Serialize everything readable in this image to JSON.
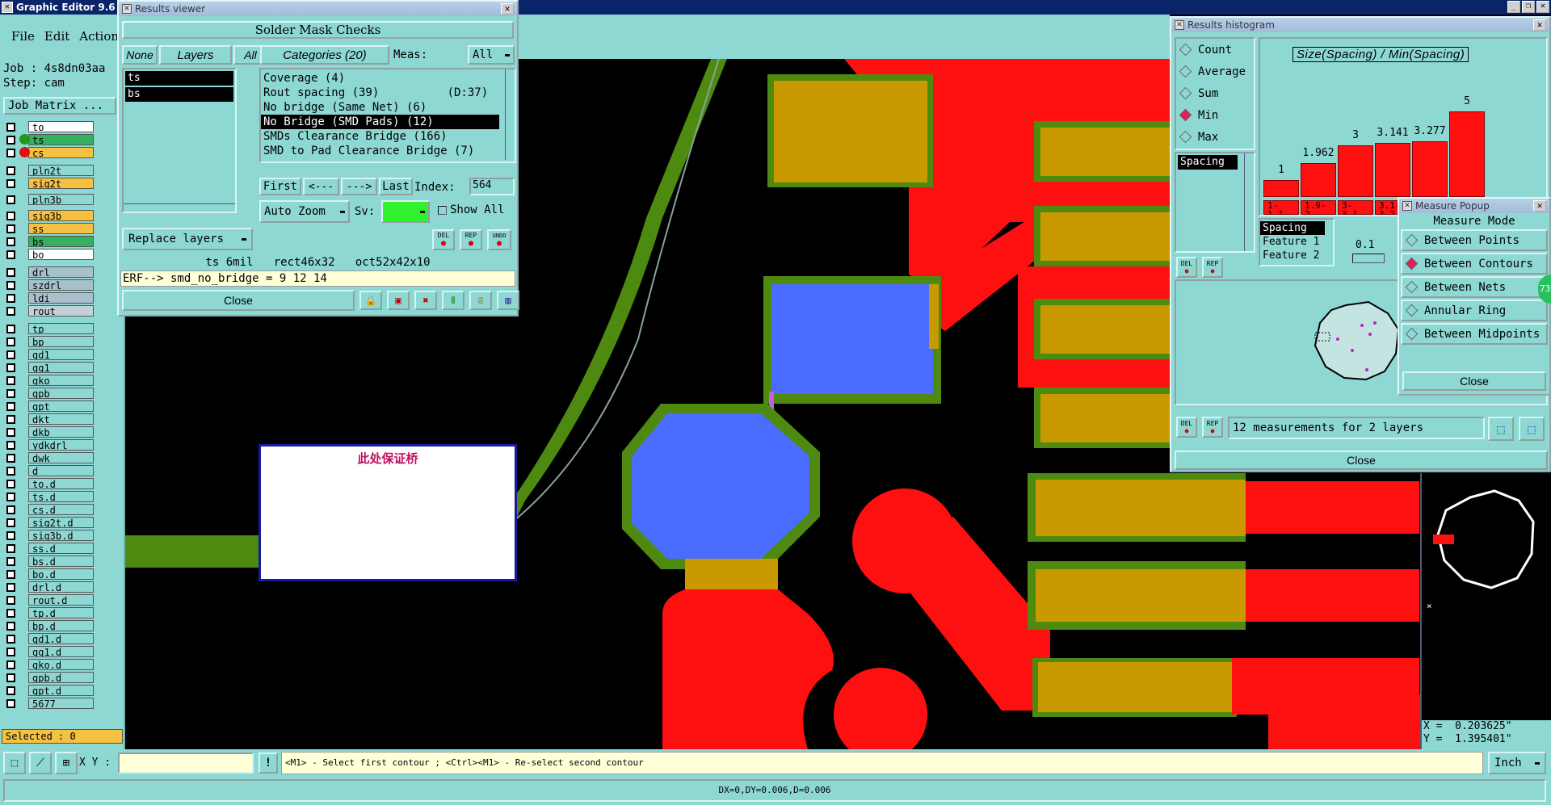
{
  "app": {
    "title": "Graphic Editor 9.6"
  },
  "menu": {
    "file": "File",
    "edit": "Edit",
    "action": "Action"
  },
  "job": {
    "line1": "Job : 4s8dn03aa",
    "line2": "Step: cam",
    "matrix_button": "Job Matrix ..."
  },
  "layers": [
    {
      "name": "to",
      "color": "#ffffff"
    },
    {
      "name": "ts",
      "color": "#34b060",
      "dot": "#1e9a1e"
    },
    {
      "name": "cs",
      "color": "#f6c040",
      "dot": "#e01010"
    },
    {
      "name": "pln2t",
      "color": "#8ed8d4"
    },
    {
      "name": "sig2t",
      "color": "#f6c040"
    },
    {
      "name": "pln3b",
      "color": "#8ed8d4"
    },
    {
      "name": "sig3b",
      "color": "#f6c040"
    },
    {
      "name": "ss",
      "color": "#f6c040"
    },
    {
      "name": "bs",
      "color": "#34b060"
    },
    {
      "name": "bo",
      "color": "#ffffff"
    },
    {
      "name": "drl",
      "color": "#a8c0cc"
    },
    {
      "name": "szdrl",
      "color": "#a8c0cc"
    },
    {
      "name": "ldi",
      "color": "#a8c0cc"
    },
    {
      "name": "rout",
      "color": "#c4d0d8"
    },
    {
      "name": "tp",
      "color": "#8ed8d4"
    },
    {
      "name": "bp",
      "color": "#8ed8d4"
    },
    {
      "name": "gd1",
      "color": "#8ed8d4"
    },
    {
      "name": "gg1",
      "color": "#8ed8d4"
    },
    {
      "name": "gko",
      "color": "#8ed8d4"
    },
    {
      "name": "gpb",
      "color": "#8ed8d4"
    },
    {
      "name": "gpt",
      "color": "#8ed8d4"
    },
    {
      "name": "dkt",
      "color": "#8ed8d4"
    },
    {
      "name": "dkb",
      "color": "#8ed8d4"
    },
    {
      "name": "ydkdrl",
      "color": "#8ed8d4"
    },
    {
      "name": "dwk",
      "color": "#8ed8d4"
    },
    {
      "name": "d",
      "color": "#8ed8d4"
    },
    {
      "name": "to.d",
      "color": "#8ed8d4"
    },
    {
      "name": "ts.d",
      "color": "#8ed8d4"
    },
    {
      "name": "cs.d",
      "color": "#8ed8d4"
    },
    {
      "name": "sig2t.d",
      "color": "#8ed8d4"
    },
    {
      "name": "sig3b.d",
      "color": "#8ed8d4"
    },
    {
      "name": "ss.d",
      "color": "#8ed8d4"
    },
    {
      "name": "bs.d",
      "color": "#8ed8d4"
    },
    {
      "name": "bo.d",
      "color": "#8ed8d4"
    },
    {
      "name": "drl.d",
      "color": "#8ed8d4"
    },
    {
      "name": "rout.d",
      "color": "#8ed8d4"
    },
    {
      "name": "tp.d",
      "color": "#8ed8d4"
    },
    {
      "name": "bp.d",
      "color": "#8ed8d4"
    },
    {
      "name": "gd1.d",
      "color": "#8ed8d4"
    },
    {
      "name": "gg1.d",
      "color": "#8ed8d4"
    },
    {
      "name": "gko.d",
      "color": "#8ed8d4"
    },
    {
      "name": "gpb.d",
      "color": "#8ed8d4"
    },
    {
      "name": "gpt.d",
      "color": "#8ed8d4"
    },
    {
      "name": "5677",
      "color": "#8ed8d4"
    }
  ],
  "selected": "Selected : 0",
  "results_viewer": {
    "title": "Results viewer",
    "header": "Solder Mask Checks",
    "none": "None",
    "layers_label": "Layers",
    "all": "All",
    "categories": "Categories (20)",
    "meas_label": "Meas:",
    "meas_value": "All",
    "layer_list": [
      "ts",
      "bs"
    ],
    "category_list": [
      "Coverage (4)",
      "Rout spacing (39)          (D:37)",
      "No bridge (Same Net) (6)",
      "No Bridge (SMD Pads) (12)",
      "SMDs Clearance Bridge (166)",
      "SMD to Pad Clearance Bridge (7)"
    ],
    "first": "First",
    "prev": "<---",
    "next": "--->",
    "last": "Last",
    "index_label": "Index:",
    "index_value": "564",
    "auto_zoom": "Auto Zoom",
    "sv_label": "Sv:",
    "show_all": "Show All",
    "replace_layers": "Replace layers",
    "del": "DEL",
    "rep": "REP",
    "undo": "UNDO",
    "info_line": "ts 6mil   rect46x32   oct52x42x10",
    "erf_line": "ERF--> smd_no_bridge = 9 12 14",
    "close": "Close"
  },
  "canvas": {
    "annotation": "此处保证桥"
  },
  "histogram": {
    "title": "Results histogram",
    "options": [
      "Count",
      "Average",
      "Sum",
      "Min",
      "Max"
    ],
    "selected_option": "Min",
    "chart_title": "Size(Spacing) / Min(Spacing)",
    "spacing_item": "Spacing",
    "bars": [
      {
        "label": "1",
        "range": "1-\n1.1",
        "value": 1
      },
      {
        "label": "1.962",
        "range": "1.9-\n2",
        "value": 1.962
      },
      {
        "label": "3",
        "range": "3-\n3.1",
        "value": 3
      },
      {
        "label": "3.141",
        "range": "3.1-\n3.2",
        "value": 3.141
      },
      {
        "label": "3.277",
        "range": "3.2-\n3.3",
        "value": 3.277
      },
      {
        "label": "5",
        "range": "5-\n5.1",
        "value": 5
      }
    ],
    "measure_list": [
      "Spacing",
      "Feature 1",
      "Feature 2"
    ],
    "threshold": "0.1",
    "footer_text": "12 measurements for 2 layers",
    "close": "Close",
    "badge": "73"
  },
  "measure_popup": {
    "title": "Measure Popup",
    "header": "Measure Mode",
    "options": [
      "Between Points",
      "Between Contours",
      "Between Nets",
      "Annular Ring",
      "Between Midpoints"
    ],
    "selected": "Between Contours",
    "close": "Close"
  },
  "coords": {
    "x": "X =  0.203625\"",
    "y": "Y =  1.395401\""
  },
  "status": {
    "xy_label": "X Y :",
    "xy_value": "",
    "message": "<M1> - Select first contour ; <Ctrl><M1> - Re-select second contour",
    "units": "Inch",
    "readout": "DX=0,DY=0.006,D=0.006"
  },
  "colors": {
    "teal": "#8ed8d4",
    "copper": "#ff1010",
    "mask": "#5a9a10",
    "pad_blue": "#4a6cff",
    "gold": "#c89a00"
  }
}
